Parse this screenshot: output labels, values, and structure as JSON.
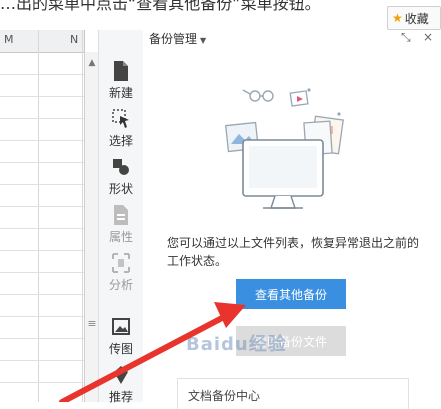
{
  "caption": {
    "text": "…出的菜单中点击“查看其他备份”菜单按钮。"
  },
  "favorite": {
    "label": "收藏"
  },
  "sheet": {
    "columns": [
      "M",
      "N"
    ]
  },
  "tools": [
    {
      "id": "new",
      "label": "新建",
      "icon": "new-file-icon",
      "enabled": true
    },
    {
      "id": "select",
      "label": "选择",
      "icon": "cursor-icon",
      "enabled": true
    },
    {
      "id": "shape",
      "label": "形状",
      "icon": "shape-icon",
      "enabled": true
    },
    {
      "id": "property",
      "label": "属性",
      "icon": "property-icon",
      "enabled": false
    },
    {
      "id": "analyze",
      "label": "分析",
      "icon": "analyze-icon",
      "enabled": false
    },
    {
      "id": "image-map",
      "label": "传图",
      "icon": "image-icon",
      "enabled": true
    },
    {
      "id": "recommend",
      "label": "推荐",
      "icon": "recommend-icon",
      "enabled": true
    }
  ],
  "panel": {
    "title": "备份管理",
    "description": "您可以通过以上文件列表，恢复异常退出之前的工作状态。",
    "view_other_label": "查看其他备份",
    "clear_label": "清除备份文件",
    "card_text": "文档备份中心"
  },
  "watermark": "Baidu经验",
  "colors": {
    "primary": "#3b8fe0",
    "arrow": "#e8342c",
    "disabled": "#dcdcdc"
  }
}
